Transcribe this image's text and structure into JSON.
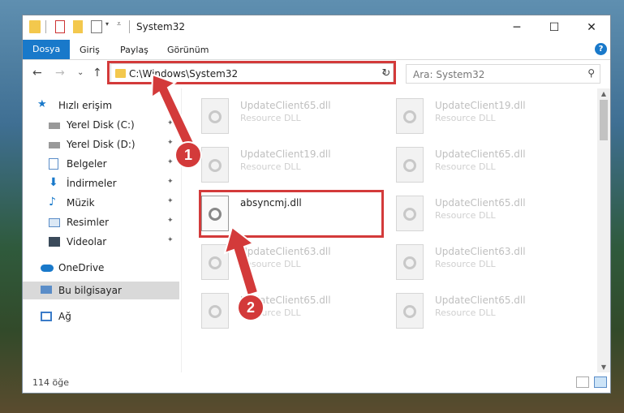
{
  "window": {
    "title": "System32",
    "controls": {
      "minimize": "─",
      "maximize": "☐",
      "close": "✕"
    }
  },
  "ribbon": {
    "tabs": [
      "Dosya",
      "Giriş",
      "Paylaş",
      "Görünüm"
    ],
    "active_tab": "Dosya",
    "help": "?"
  },
  "nav": {
    "back": "←",
    "forward": "→",
    "recent": "⌄",
    "up": "↑",
    "address": "C:\\Windows\\System32",
    "refresh": "↻",
    "search_placeholder": "Ara: System32"
  },
  "sidebar": {
    "items": [
      {
        "label": "Hızlı erişim",
        "icon": "star-icon",
        "pinned": false
      },
      {
        "label": "Yerel Disk (C:)",
        "icon": "drive-icon",
        "pinned": true
      },
      {
        "label": "Yerel Disk (D:)",
        "icon": "drive-icon",
        "pinned": true
      },
      {
        "label": "Belgeler",
        "icon": "documents-icon",
        "pinned": true
      },
      {
        "label": "İndirmeler",
        "icon": "download-icon",
        "pinned": true
      },
      {
        "label": "Müzik",
        "icon": "music-icon",
        "pinned": true
      },
      {
        "label": "Resimler",
        "icon": "pictures-icon",
        "pinned": true
      },
      {
        "label": "Videolar",
        "icon": "video-icon",
        "pinned": true
      },
      {
        "label": "OneDrive",
        "icon": "cloud-icon",
        "pinned": false
      },
      {
        "label": "Bu bilgisayar",
        "icon": "computer-icon",
        "pinned": false,
        "selected": true
      },
      {
        "label": "Ağ",
        "icon": "network-icon",
        "pinned": false
      }
    ],
    "pin_glyph": "📌"
  },
  "files": [
    {
      "name": "UpdateClient65.dll",
      "desc": "Resource DLL"
    },
    {
      "name": "UpdateClient19.dll",
      "desc": "Resource DLL"
    },
    {
      "name": "UpdateClient19.dll",
      "desc": "Resource DLL"
    },
    {
      "name": "UpdateClient65.dll",
      "desc": "Resource DLL"
    },
    {
      "name": "absyncmj.dll",
      "desc": "",
      "focused": true
    },
    {
      "name": "UpdateClient65.dll",
      "desc": "Resource DLL"
    },
    {
      "name": "UpdateClient63.dll",
      "desc": "Resource DLL"
    },
    {
      "name": "UpdateClient63.dll",
      "desc": "Resource DLL"
    },
    {
      "name": "UpdateClient65.dll",
      "desc": "Resource DLL"
    },
    {
      "name": "UpdateClient65.dll",
      "desc": "Resource DLL"
    }
  ],
  "status": {
    "item_count": "114 öğe"
  },
  "callouts": {
    "one": "1",
    "two": "2"
  },
  "colors": {
    "accent": "#1979ca",
    "highlight": "#d33a3a",
    "folder": "#f3c84d"
  }
}
